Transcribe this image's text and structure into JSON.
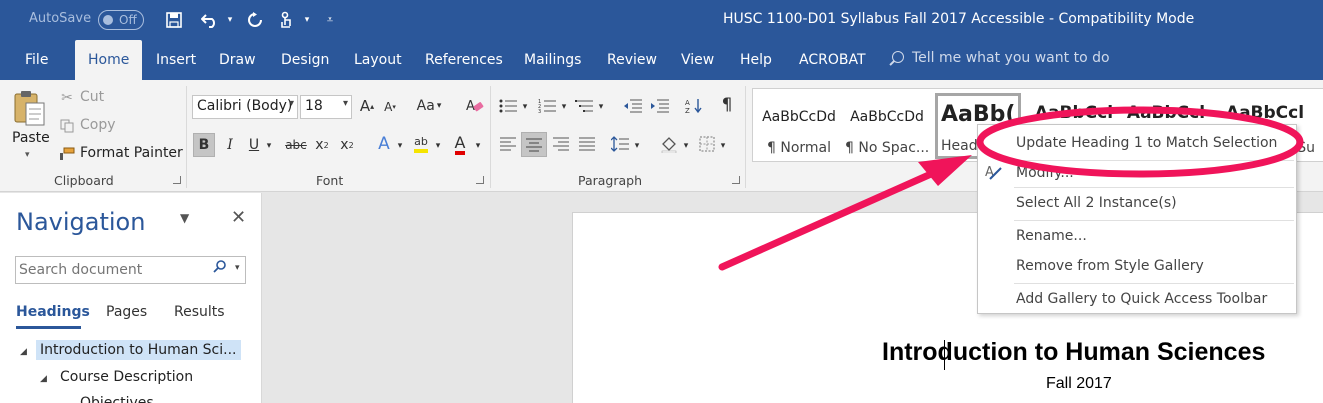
{
  "titlebar": {
    "autosave_label": "AutoSave",
    "autosave_state": "Off",
    "document_title": "HUSC 1100-D01 Syllabus Fall 2017 Accessible  -  Compatibility Mode",
    "quick_access": [
      "save-icon",
      "undo-icon",
      "redo-icon",
      "touch-mode-icon",
      "customize-icon"
    ]
  },
  "tabs": [
    "File",
    "Home",
    "Insert",
    "Draw",
    "Design",
    "Layout",
    "References",
    "Mailings",
    "Review",
    "View",
    "Help",
    "ACROBAT"
  ],
  "active_tab": "Home",
  "tell_me": "Tell me what you want to do",
  "clipboard": {
    "paste": "Paste",
    "cut": "Cut",
    "copy": "Copy",
    "format_painter": "Format Painter",
    "group_label": "Clipboard"
  },
  "font": {
    "font_name": "Calibri (Body)",
    "font_size": "18",
    "group_label": "Font",
    "bold": "B",
    "italic": "I",
    "underline": "U",
    "strike": "abc",
    "subscript": "x",
    "subscript_mark": "2",
    "superscript": "x",
    "superscript_mark": "2",
    "grow": "A",
    "shrink": "A",
    "change_case": "Aa",
    "text_effects": "A",
    "font_color": "A",
    "highlight": "ab"
  },
  "paragraph": {
    "group_label": "Paragraph",
    "show_marks": "¶"
  },
  "styles": [
    {
      "preview": "AaBbCcDd",
      "name": "¶ Normal"
    },
    {
      "preview": "AaBbCcDd",
      "name": "¶ No Spac..."
    },
    {
      "preview": "AaBb(",
      "name": "Head"
    },
    {
      "preview": "AaBbCcl",
      "name": ""
    },
    {
      "preview": "AaBbCcl",
      "name": ""
    },
    {
      "preview": "AaBbCcl",
      "name": "Su"
    }
  ],
  "context_menu": {
    "update": "Update Heading 1 to Match Selection",
    "modify": "Modify...",
    "select_all": "Select All 2 Instance(s)",
    "rename": "Rename...",
    "remove": "Remove from Style Gallery",
    "add_gallery": "Add Gallery to Quick Access Toolbar"
  },
  "navigation": {
    "title": "Navigation",
    "search_placeholder": "Search document",
    "tabs": [
      "Headings",
      "Pages",
      "Results"
    ],
    "tree": [
      {
        "label": "Introduction to Human Sci...",
        "level": 0
      },
      {
        "label": "Course Description",
        "level": 1
      },
      {
        "label": "Objectives",
        "level": 2
      }
    ]
  },
  "document": {
    "heading": "Introduction to Human Sciences",
    "subheading": "Fall 2017"
  },
  "colors": {
    "accent": "#2b579a",
    "annotation": "#f0145a"
  }
}
